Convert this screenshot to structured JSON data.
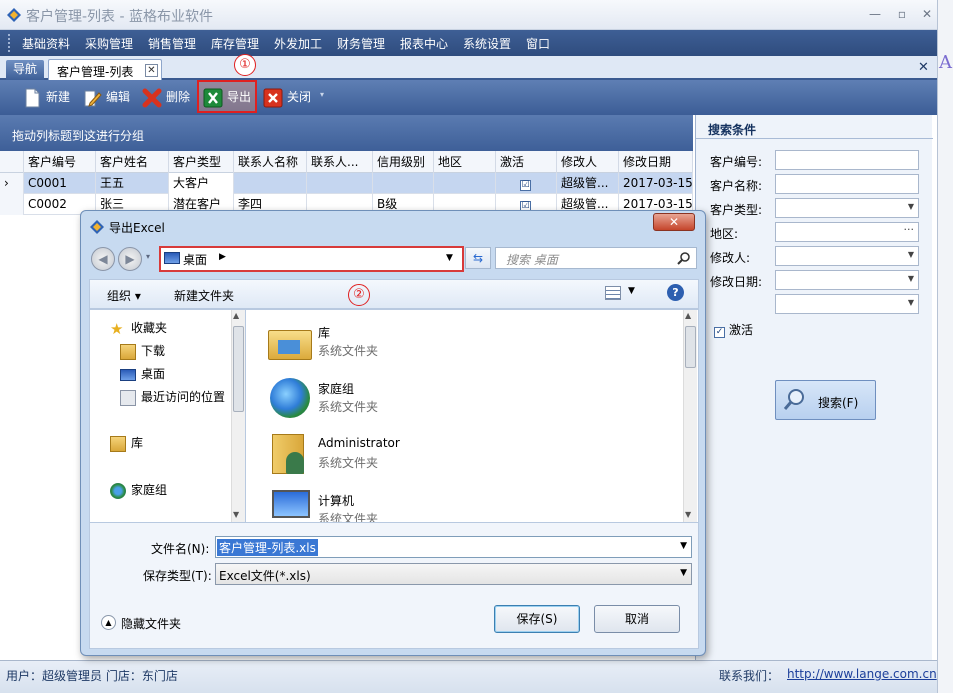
{
  "window": {
    "title": "客户管理-列表 - 蓝格布业软件"
  },
  "menu": [
    "基础资料",
    "采购管理",
    "销售管理",
    "库存管理",
    "外发加工",
    "财务管理",
    "报表中心",
    "系统设置",
    "窗口"
  ],
  "tabs": {
    "nav": "导航",
    "customer_list": "客户管理-列表"
  },
  "toolbar": {
    "new": "新建",
    "edit": "编辑",
    "delete": "删除",
    "export": "导出",
    "close": "关闭"
  },
  "annotations": {
    "one": "①",
    "two": "②"
  },
  "grid": {
    "group_hint": "拖动列标题到这进行分组",
    "columns": [
      "客户编号",
      "客户姓名",
      "客户类型",
      "联系人名称",
      "联系人...",
      "信用级别",
      "地区",
      "激活",
      "修改人",
      "修改日期"
    ],
    "rows": [
      [
        "C0001",
        "王五",
        "大客户",
        "",
        "",
        "",
        "",
        "☑",
        "超级管...",
        "2017-03-15"
      ],
      [
        "C0002",
        "张三",
        "潜在客户",
        "李四",
        "",
        "B级",
        "",
        "☑",
        "超级管...",
        "2017-03-15"
      ]
    ]
  },
  "search": {
    "title": "搜索条件",
    "labels": [
      "客户编号:",
      "客户名称:",
      "客户类型:",
      "地区:",
      "修改人:",
      "修改日期:"
    ],
    "active_label": "激活",
    "button": "搜索(F)",
    "ellipsis": "···"
  },
  "status": {
    "user": "用户：超级管理员  门店：东门店",
    "contact_label": "联系我们：",
    "url": "http://www.lange.com.cn"
  },
  "dialog": {
    "title": "导出Excel",
    "address": "桌面",
    "search_placeholder": "搜索 桌面",
    "organize": "组织 ▾",
    "new_folder": "新建文件夹",
    "nav": {
      "favorites": "收藏夹",
      "downloads": "下载",
      "desktop": "桌面",
      "recent": "最近访问的位置",
      "libraries": "库",
      "homegroup": "家庭组"
    },
    "files": [
      {
        "name": "库",
        "type": "系统文件夹"
      },
      {
        "name": "家庭组",
        "type": "系统文件夹"
      },
      {
        "name": "Administrator",
        "type": "系统文件夹"
      },
      {
        "name": "计算机",
        "type": "系统文件夹"
      }
    ],
    "filename_label": "文件名(N):",
    "filename": "客户管理-列表.xls",
    "filetype_label": "保存类型(T):",
    "filetype": "Excel文件(*.xls)",
    "hide_folders": "隐藏文件夹",
    "save": "保存(S)",
    "cancel": "取消"
  },
  "colors": {
    "menu_bg": "#2f4c7e",
    "highlight": "#e02020",
    "selected_row": "#c5d6f0"
  }
}
